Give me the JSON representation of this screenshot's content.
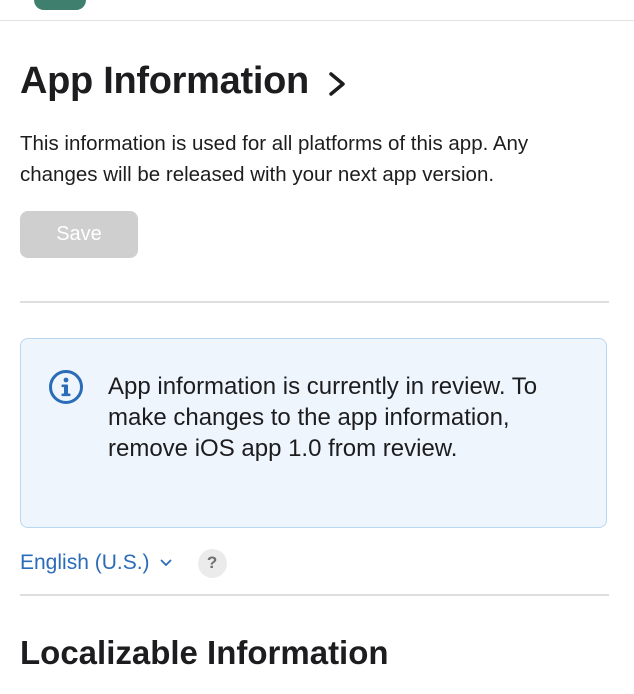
{
  "header": {
    "title": "App Information",
    "description": "This information is used for all platforms of this app. Any changes will be released with your next app version."
  },
  "actions": {
    "save_label": "Save"
  },
  "notice": {
    "text": "App information is currently in review. To make changes to the app information, remove iOS app 1.0 from review."
  },
  "localization": {
    "selected_language": "English (U.S.)",
    "help_label": "?"
  },
  "sections": {
    "localizable_title": "Localizable Information"
  },
  "colors": {
    "accent_blue": "#2b6cb8",
    "brand_green": "#3f7f6d",
    "disabled_button": "#cfcfcf",
    "notice_background": "#eef5fc",
    "notice_border": "#b9d7f1"
  },
  "icons": {
    "title_chevron": "chevron-right-icon",
    "notice": "info-icon",
    "language_dropdown": "chevron-down-icon"
  }
}
